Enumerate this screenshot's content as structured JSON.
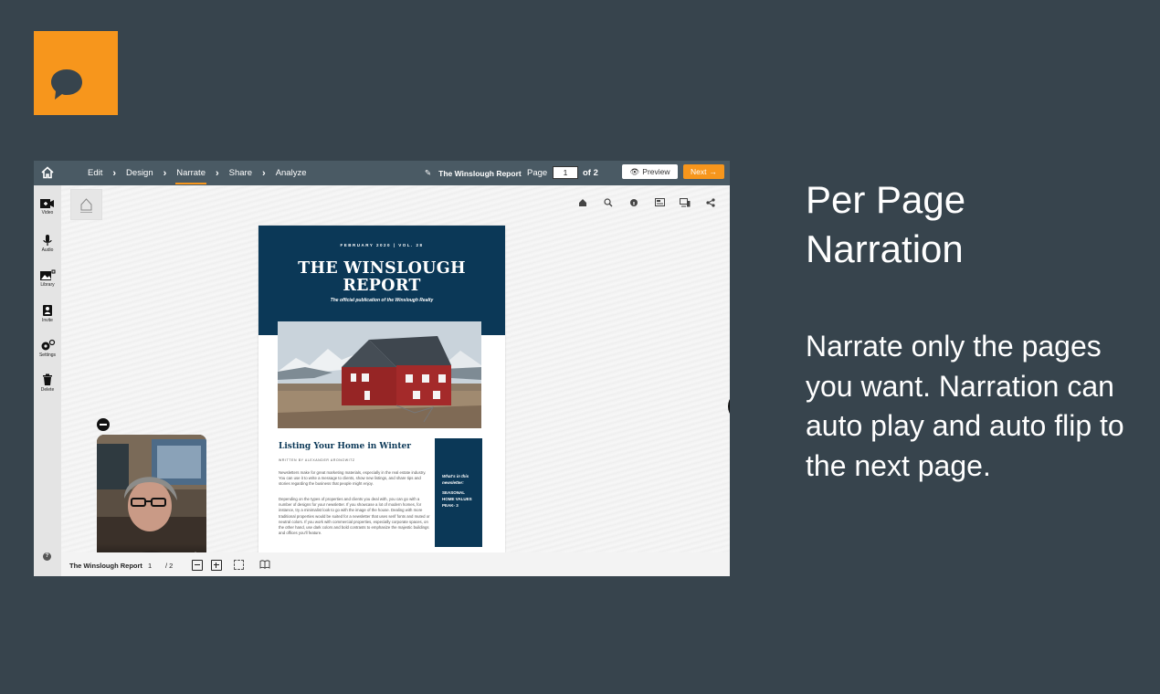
{
  "logo": {
    "icon": "chat-bubble-icon",
    "color": "#f7961c"
  },
  "topbar": {
    "steps": [
      "Edit",
      "Design",
      "Narrate",
      "Share",
      "Analyze"
    ],
    "active_step": "Narrate",
    "doc_title": "The Winslough Report",
    "page_label": "Page",
    "page_value": "1",
    "of_total": "of 2",
    "preview_label": "Preview",
    "next_label": "Next"
  },
  "sidebar": {
    "items": [
      {
        "label": "Video",
        "icon": "video-add-icon"
      },
      {
        "label": "Audio",
        "icon": "microphone-icon"
      },
      {
        "label": "Library",
        "icon": "library-icon"
      },
      {
        "label": "Invite",
        "icon": "invite-icon"
      },
      {
        "label": "Settings",
        "icon": "gear-icon"
      },
      {
        "label": "Delete",
        "icon": "trash-icon"
      }
    ],
    "help": "?"
  },
  "newsletter": {
    "date": "FEBRUARY 2020 | VOL. 28",
    "title_line1": "THE WINSLOUGH",
    "title_line2": "REPORT",
    "subtitle": "The official publication of the Winslough Realty",
    "article_title": "Listing Your Home in Winter",
    "byline": "WRITTEN BY ALEXANDER ARONOWITZ",
    "body1": "Newsletters make for great marketing materials, especially in the real estate industry. You can use it to write a message to clients, show new listings, and share tips and stories regarding the business that people might enjoy.",
    "body2": "Depending on the types of properties and clients you deal with, you can go with a number of designs for your newsletter. If you showcase a lot of modern homes, for instance, try a minimalist look to go with the image of the house. Dealing with more traditional properties would be suited for a newsletter that uses serif fonts and muted or neutral colors. If you work with commercial properties, especially corporate spaces, on the other hand, use dark colors and bold contrasts to emphasize the majestic buildings and offices you'll feature.",
    "sidebox_q1": "What's in this",
    "sidebox_q2": "newsletter:",
    "sidebox_a1": "SEASONAL",
    "sidebox_a2": "HOME VALUES",
    "sidebox_a3": "PEAK- 3",
    "navy": "#0b3857"
  },
  "bottombar": {
    "title": "The Winslough Report",
    "page": "1",
    "total": "/ 2"
  },
  "headline": {
    "line1": "Per Page",
    "line2": "Narration"
  },
  "description": "Narrate only the pages you want. Narration can auto play and auto flip to the next page."
}
